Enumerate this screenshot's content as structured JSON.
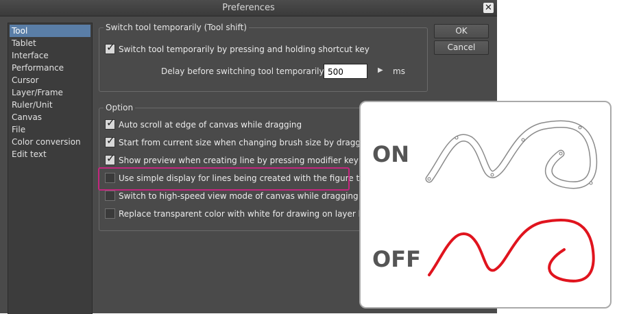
{
  "window": {
    "title": "Preferences",
    "close_glyph": "✕"
  },
  "sidebar": {
    "items": [
      {
        "label": "Tool",
        "selected": true
      },
      {
        "label": "Tablet"
      },
      {
        "label": "Interface"
      },
      {
        "label": "Performance"
      },
      {
        "label": "Cursor"
      },
      {
        "label": "Layer/Frame"
      },
      {
        "label": "Ruler/Unit"
      },
      {
        "label": "Canvas"
      },
      {
        "label": "File"
      },
      {
        "label": "Color conversion"
      },
      {
        "label": "Edit text"
      }
    ]
  },
  "buttons": {
    "ok": "OK",
    "cancel": "Cancel"
  },
  "switch_group": {
    "label": "Switch tool temporarily (Tool shift)",
    "checkbox_label": "Switch tool temporarily by pressing and holding shortcut key",
    "checked": true,
    "delay_label": "Delay before switching tool temporarily(K):",
    "delay_value": "500",
    "delay_unit": "ms"
  },
  "option_group": {
    "label": "Option",
    "items": [
      {
        "label": "Auto scroll at edge of canvas while dragging",
        "checked": true
      },
      {
        "label": "Start from current size when changing brush size by dragging on car",
        "checked": true
      },
      {
        "label": "Show preview when creating line by pressing modifier key (Shift)",
        "checked": true
      },
      {
        "label": "Use simple display for lines being created with the figure tools",
        "checked": false
      },
      {
        "label": "Switch to high-speed view mode of canvas while dragging viewing to",
        "checked": false
      },
      {
        "label": "Replace transparent color with white for drawing on layer locking tra",
        "checked": false
      }
    ]
  },
  "callout": {
    "on_label": "ON",
    "off_label": "OFF",
    "off_stroke_color": "#e0141e",
    "on_stroke_color": "#888888"
  },
  "colors": {
    "highlight": "#c4267e",
    "selection": "#5a7ea7"
  }
}
